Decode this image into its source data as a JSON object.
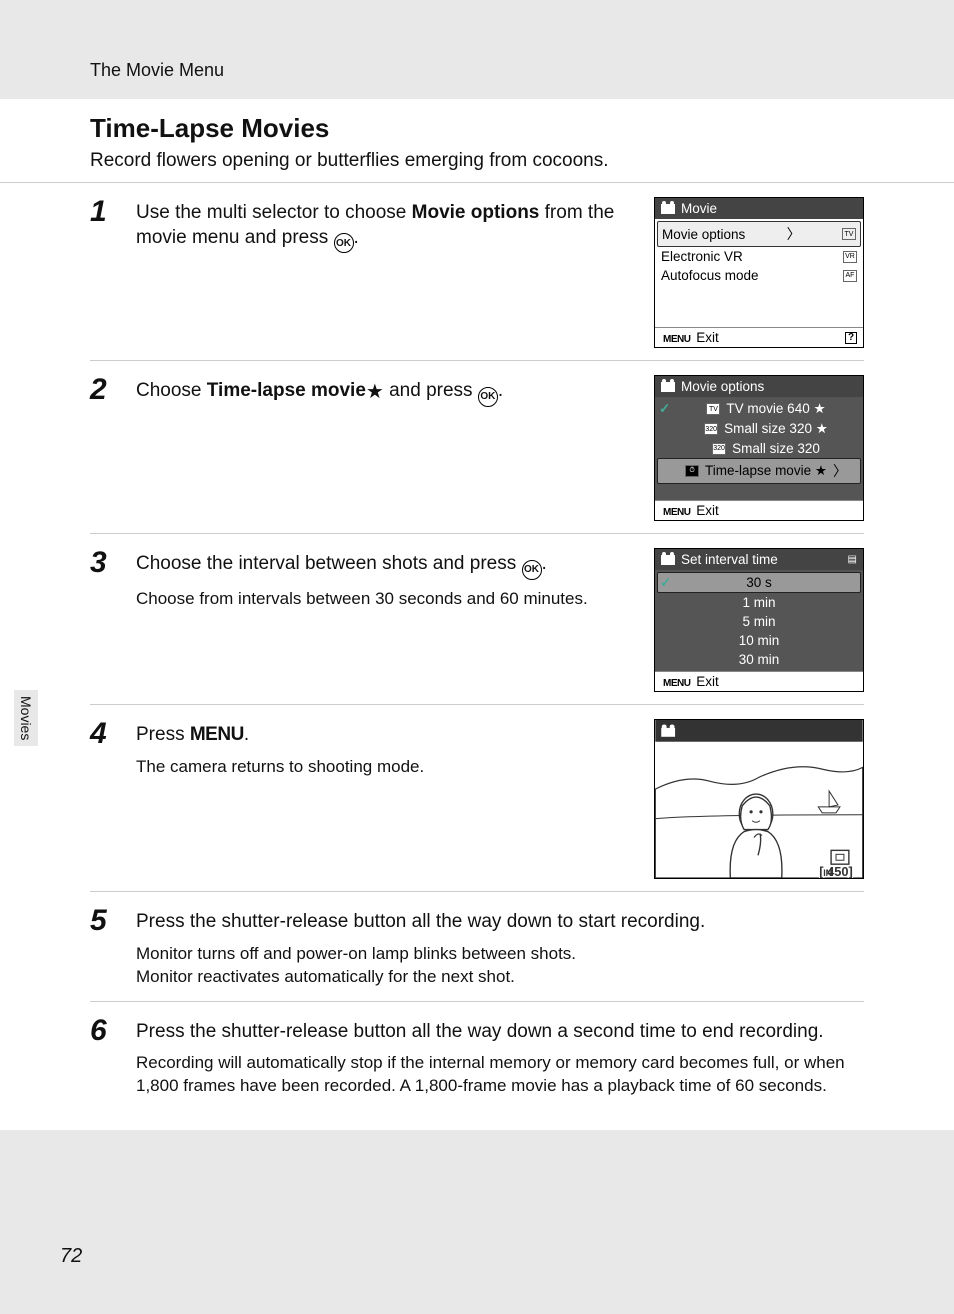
{
  "header_path": "The Movie Menu",
  "title": "Time-Lapse Movies",
  "subtitle": "Record flowers opening or butterflies emerging from cocoons.",
  "side_tab": "Movies",
  "page_number": "72",
  "ok_label": "OK",
  "menu_label": "MENU",
  "exit_label": "Exit",
  "help_label": "?",
  "star": "★",
  "steps": [
    {
      "num": "1",
      "instruction_pre": "Use the multi selector to choose ",
      "instruction_bold": "Movie options",
      "instruction_post": " from the movie menu and press ",
      "detail": ""
    },
    {
      "num": "2",
      "instruction_pre": "Choose ",
      "instruction_bold": "Time-lapse movie",
      "instruction_post": " and press ",
      "detail": ""
    },
    {
      "num": "3",
      "instruction_pre": "Choose the interval between shots and press ",
      "instruction_bold": "",
      "instruction_post": "",
      "detail": "Choose from intervals between 30 seconds and 60 minutes."
    },
    {
      "num": "4",
      "instruction_pre": "Press ",
      "instruction_bold": "",
      "instruction_post": ".",
      "detail": "The camera returns to shooting mode."
    },
    {
      "num": "5",
      "instruction_pre": "Press the shutter-release button all the way down to start recording.",
      "instruction_bold": "",
      "instruction_post": "",
      "detail": "Monitor turns off and power-on lamp blinks between shots.\nMonitor reactivates automatically for the next shot."
    },
    {
      "num": "6",
      "instruction_pre": "Press the shutter-release button all the way down a second time to end recording.",
      "instruction_bold": "",
      "instruction_post": "",
      "detail": "Recording will automatically stop if the internal memory or memory card becomes full, or when 1,800 frames have been recorded. A 1,800-frame movie has a playback time of 60 seconds."
    }
  ],
  "cam1": {
    "title": "Movie",
    "items": [
      "Movie options",
      "Electronic VR",
      "Autofocus mode"
    ]
  },
  "cam2": {
    "title": "Movie options",
    "items": [
      "TV movie 640 ★",
      "Small size 320 ★",
      "Small size 320",
      "Time-lapse movie ★"
    ]
  },
  "cam3": {
    "title": "Set interval time",
    "items": [
      "30 s",
      "1 min",
      "5 min",
      "10 min",
      "30 min"
    ]
  },
  "cam4_counter": "450"
}
